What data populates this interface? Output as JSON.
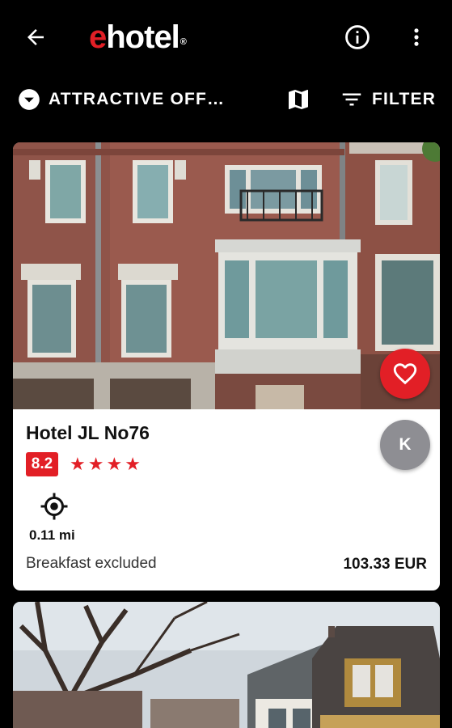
{
  "appbar": {
    "logo_e": "e",
    "logo_rest": "hotel",
    "logo_reg": "®",
    "back_icon": "arrow-back-icon",
    "info_icon": "info-icon",
    "more_icon": "more-vert-icon"
  },
  "toolbar": {
    "sort_label": "ATTRACTIVE OFF…",
    "sort_icon": "chevron-down-circle-icon",
    "map_icon": "map-icon",
    "filter_label": "FILTER",
    "filter_icon": "filter-lines-icon"
  },
  "hotels": [
    {
      "name": "Hotel JL No76",
      "rating": "8.2",
      "stars": 4,
      "distance": "0.11 mi",
      "meal": "Breakfast excluded",
      "price": "103.33 EUR",
      "avatar_initial": "K",
      "favorite_icon": "heart-icon",
      "location_icon": "crosshair-location-icon"
    }
  ],
  "colors": {
    "brand_red": "#e21f26",
    "background": "#000000",
    "card": "#ffffff",
    "avatar_gray": "#8e8e93"
  }
}
